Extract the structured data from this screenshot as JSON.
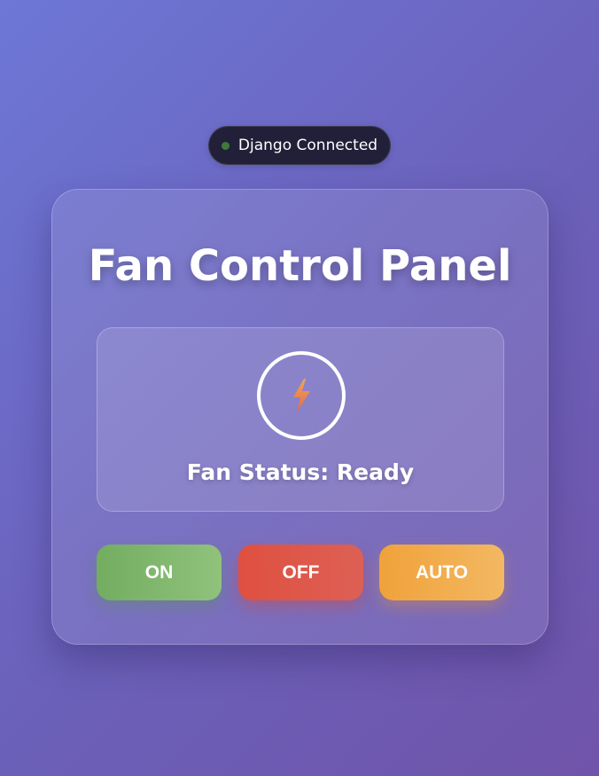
{
  "connection": {
    "label": "Django Connected",
    "dot_color": "#3f7a3c"
  },
  "panel": {
    "title": "Fan Control Panel",
    "status_icon": "lightning-bolt-icon",
    "status_text": "Fan Status: Ready"
  },
  "controls": {
    "on_label": "ON",
    "off_label": "OFF",
    "auto_label": "AUTO",
    "on_color": "#7bb468",
    "off_color": "#de5749",
    "auto_color": "#f1ab4b"
  }
}
